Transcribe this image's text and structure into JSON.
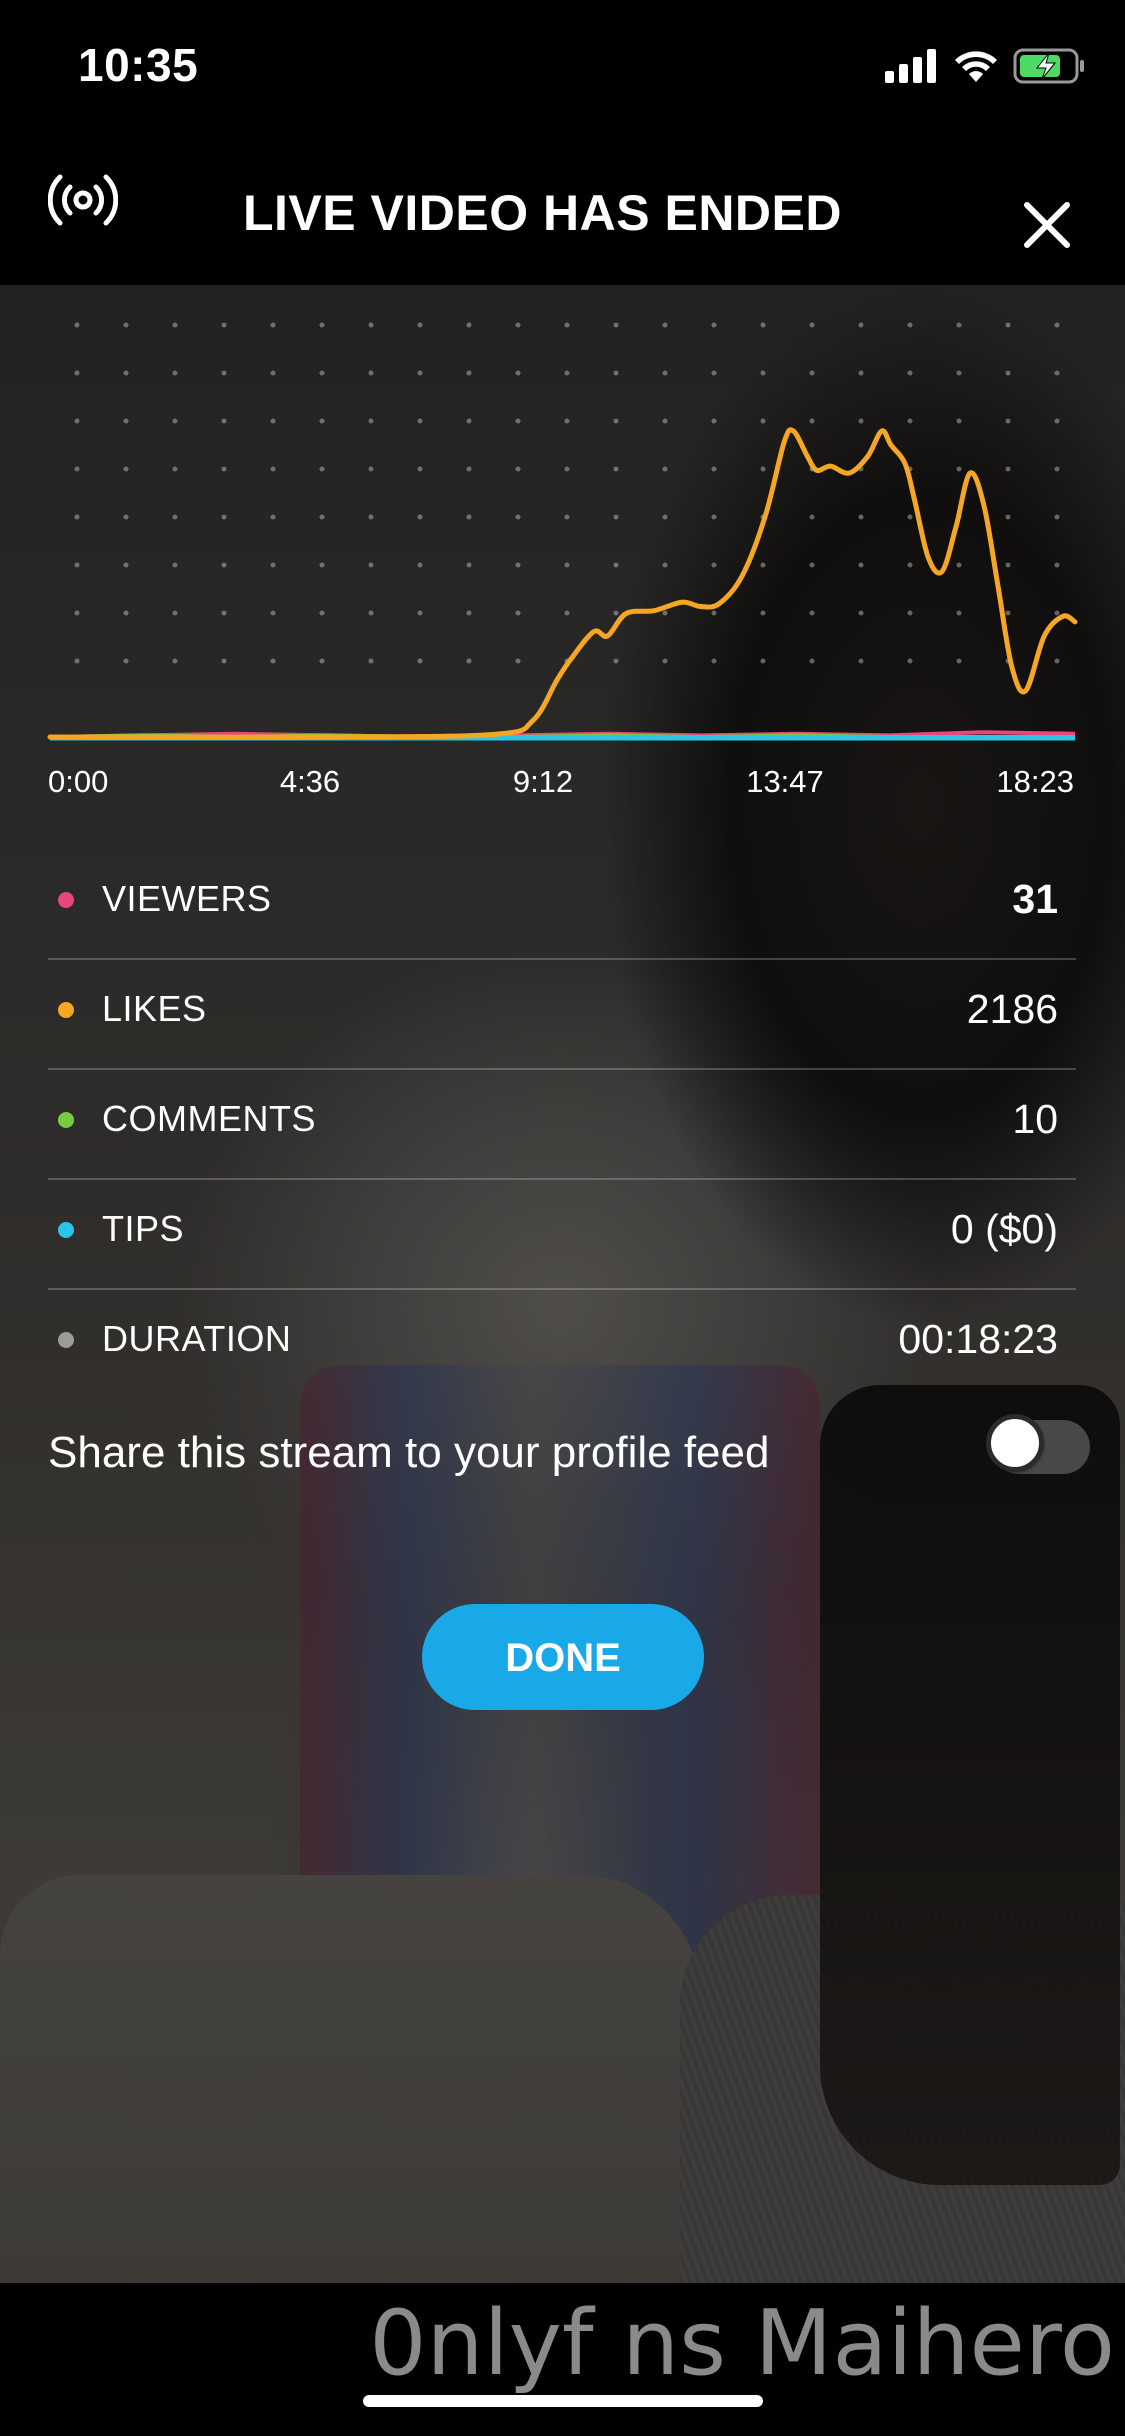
{
  "status_bar": {
    "time": "10:35"
  },
  "header": {
    "title": "LIVE VIDEO HAS ENDED"
  },
  "chart_data": {
    "type": "line",
    "title": "",
    "xlabel": "",
    "ylabel": "",
    "x_ticks": [
      "0:00",
      "4:36",
      "9:12",
      "13:47",
      "18:23"
    ],
    "x_range_seconds": [
      0,
      1103
    ],
    "grid": "dots",
    "series": [
      {
        "name": "LIKES",
        "color": "#f5a623",
        "x_seconds": [
          0,
          300,
          480,
          520,
          545,
          560,
          585,
          600,
          620,
          650,
          680,
          700,
          720,
          745,
          770,
          790,
          800,
          815,
          825,
          840,
          860,
          880,
          895,
          905,
          920,
          930,
          945,
          960,
          975,
          990,
          1005,
          1020,
          1035,
          1050,
          1070,
          1090,
          1103
        ],
        "values": [
          0,
          0,
          2,
          12,
          40,
          55,
          75,
          72,
          88,
          90,
          96,
          93,
          95,
          115,
          158,
          210,
          218,
          200,
          190,
          193,
          188,
          200,
          218,
          208,
          195,
          170,
          128,
          118,
          150,
          188,
          165,
          108,
          50,
          33,
          72,
          86,
          82
        ]
      },
      {
        "name": "VIEWERS",
        "color": "#e8467c",
        "values": [
          0,
          1,
          2,
          1,
          0,
          1,
          2,
          1,
          2,
          1,
          3,
          2
        ]
      },
      {
        "name": "COMMENTS",
        "color": "#7ac943",
        "values": [
          0,
          1,
          0,
          1,
          0,
          0,
          1,
          0,
          1,
          0,
          0,
          0
        ]
      },
      {
        "name": "TIPS",
        "color": "#29c6e6",
        "values": [
          0,
          0,
          0,
          0,
          0,
          0,
          0,
          0,
          0,
          0,
          0,
          0
        ]
      }
    ]
  },
  "stats": [
    {
      "label": "VIEWERS",
      "value": "31",
      "color": "#e8467c"
    },
    {
      "label": "LIKES",
      "value": "2186",
      "color": "#f5a623"
    },
    {
      "label": "COMMENTS",
      "value": "10",
      "color": "#7ac943"
    },
    {
      "label": "TIPS",
      "value": "0 ($0)",
      "color": "#29c6e6"
    },
    {
      "label": "DURATION",
      "value": "00:18:23",
      "color": "#9b9b9b"
    }
  ],
  "share": {
    "label": "Share this stream to your profile feed",
    "enabled": false
  },
  "done_button": {
    "label": "DONE"
  },
  "watermark": {
    "text": "0nlyf ns Maihero"
  }
}
